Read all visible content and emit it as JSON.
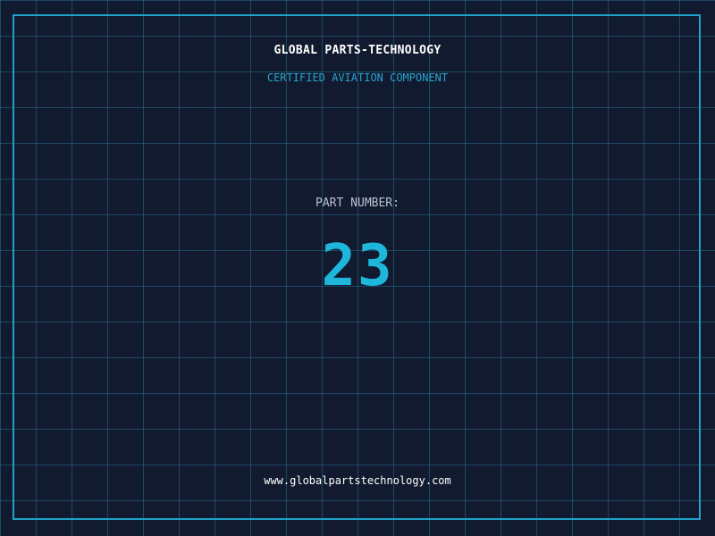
{
  "header": {
    "company_name": "GLOBAL PARTS-TECHNOLOGY",
    "tagline": "CERTIFIED AVIATION COMPONENT"
  },
  "part": {
    "label": "PART NUMBER:",
    "number": "23"
  },
  "footer": {
    "website": "www.globalpartstechnology.com"
  },
  "colors": {
    "background": "#111a2e",
    "grid": "#266e8c",
    "frame": "#1fa2c9",
    "accent": "#1fb6dc",
    "label": "#b9c3d1",
    "text": "#ffffff"
  }
}
